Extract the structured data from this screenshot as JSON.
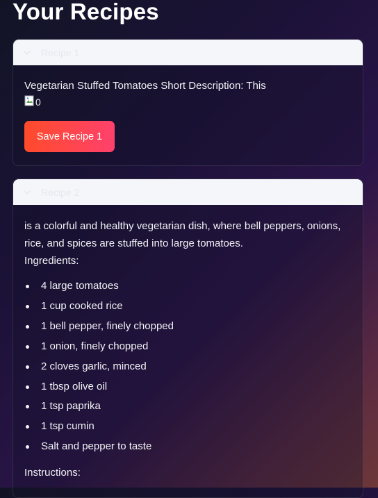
{
  "page": {
    "title": "Your Recipes"
  },
  "colors": {
    "button_start": "#ff4b2b",
    "button_end": "#ff416c",
    "expander_header": "#f5f6f9"
  },
  "recipes": [
    {
      "expander_label": "Recipe 1",
      "text": "Vegetarian Stuffed Tomatoes Short Description: This",
      "image_alt": "0",
      "save_label": "Save Recipe 1"
    },
    {
      "expander_label": "Recipe 2",
      "text": "is a colorful and healthy vegetarian dish, where bell peppers, onions, rice, and spices are stuffed into large tomatoes.",
      "ingredients_heading": "Ingredients:",
      "ingredients": [
        "4 large tomatoes",
        "1 cup cooked rice",
        "1 bell pepper, finely chopped",
        "1 onion, finely chopped",
        "2 cloves garlic, minced",
        "1 tbsp olive oil",
        "1 tsp paprika",
        "1 tsp cumin",
        "Salt and pepper to taste"
      ],
      "instructions_heading": "Instructions:"
    }
  ]
}
